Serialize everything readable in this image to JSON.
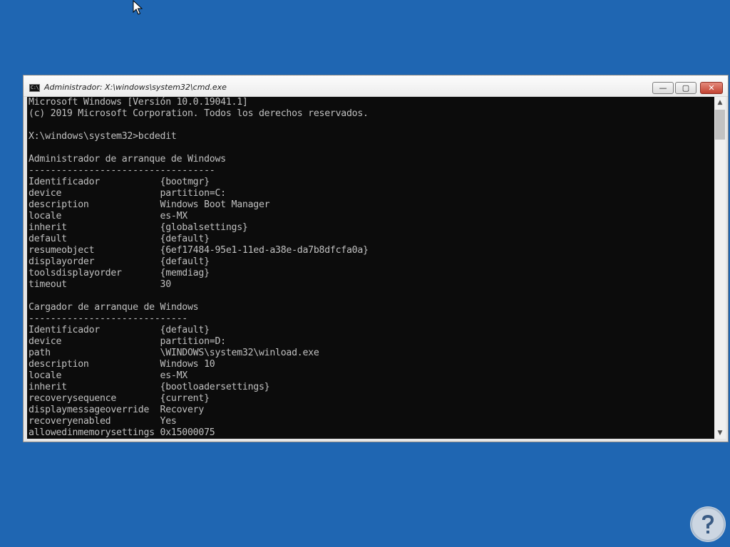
{
  "window": {
    "title": "Administrador: X:\\windows\\system32\\cmd.exe",
    "icon_text": "C:\\",
    "controls": {
      "minimize": "—",
      "maximize": "▢",
      "close": "✕"
    }
  },
  "console": {
    "lines": [
      "Microsoft Windows [Versión 10.0.19041.1]",
      "(c) 2019 Microsoft Corporation. Todos los derechos reservados.",
      "",
      "X:\\windows\\system32>bcdedit",
      "",
      "Administrador de arranque de Windows",
      "----------------------------------",
      "Identificador           {bootmgr}",
      "device                  partition=C:",
      "description             Windows Boot Manager",
      "locale                  es-MX",
      "inherit                 {globalsettings}",
      "default                 {default}",
      "resumeobject            {6ef17484-95e1-11ed-a38e-da7b8dfcfa0a}",
      "displayorder            {default}",
      "toolsdisplayorder       {memdiag}",
      "timeout                 30",
      "",
      "Cargador de arranque de Windows",
      "-----------------------------",
      "Identificador           {default}",
      "device                  partition=D:",
      "path                    \\WINDOWS\\system32\\winload.exe",
      "description             Windows 10",
      "locale                  es-MX",
      "inherit                 {bootloadersettings}",
      "recoverysequence        {current}",
      "displaymessageoverride  Recovery",
      "recoveryenabled         Yes",
      "allowedinmemorysettings 0x15000075"
    ]
  },
  "scrollbar": {
    "up_arrow": "▲",
    "down_arrow": "▼"
  },
  "colors": {
    "desktop": "#1f66b2",
    "console_bg": "#0c0c0c",
    "console_text": "#c0c0c0"
  },
  "icons": {
    "cursor": "arrow-cursor-icon",
    "window": "cmd-icon",
    "watermark": "solvetic-logo-icon"
  }
}
